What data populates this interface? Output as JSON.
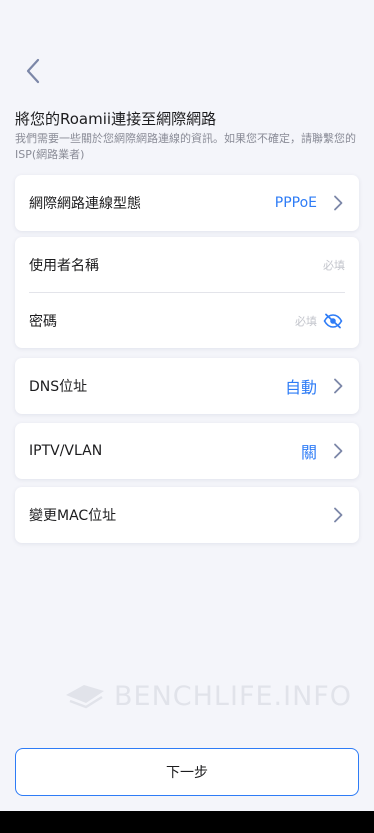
{
  "header": {
    "back_icon": "chevron-left-icon",
    "title": "將您的Roamii連接至網際網路",
    "subtitle": "我們需要一些關於您網際網路連線的資訊。如果您不確定，請聯繫您的ISP(網路業者)"
  },
  "connection_type": {
    "label": "網際網路連線型態",
    "value": "PPPoE"
  },
  "credentials": {
    "username_label": "使用者名稱",
    "username_placeholder": "必填",
    "password_label": "密碼",
    "password_placeholder": "必填",
    "password_toggle_icon": "eye-off-icon"
  },
  "dns": {
    "label": "DNS位址",
    "value": "自動"
  },
  "iptv": {
    "label": "IPTV/VLAN",
    "value": "關"
  },
  "mac": {
    "label": "變更MAC位址"
  },
  "watermark": {
    "text": "BENCHLIFE.INFO"
  },
  "footer": {
    "next_label": "下一步"
  },
  "colors": {
    "accent": "#2e7cf6",
    "background": "#f4f5fa",
    "card": "#ffffff",
    "muted": "#8a8c97"
  }
}
